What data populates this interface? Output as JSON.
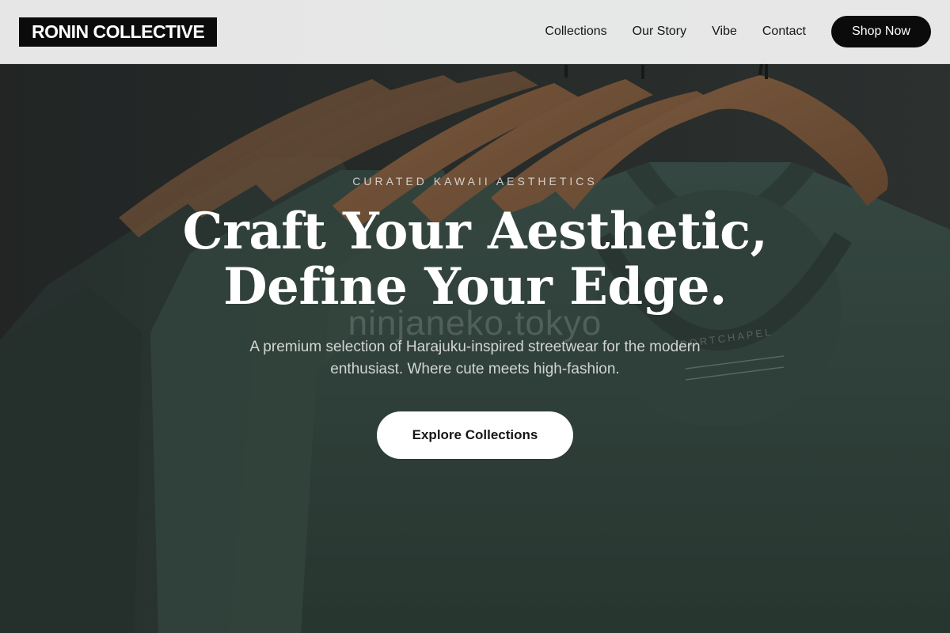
{
  "header": {
    "logo": "RONIN COLLECTIVE",
    "nav": [
      {
        "label": "Collections"
      },
      {
        "label": "Our Story"
      },
      {
        "label": "Vibe"
      },
      {
        "label": "Contact"
      }
    ],
    "shop_button": "Shop Now"
  },
  "hero": {
    "eyebrow": "CURATED KAWAII AESTHETICS",
    "headline_line1": "Craft Your Aesthetic,",
    "headline_line2": "Define Your Edge.",
    "watermark": "ninjaneko.tokyo",
    "subtext_line1": "A premium selection of Harajuku-inspired streetwear for the modern",
    "subtext_line2": "enthusiast. Where cute meets high-fashion.",
    "cta": "Explore Collections",
    "background_photo": {
      "description_icon": "hanging-tshirts-photo",
      "label_text": "PORTCHAPEL"
    }
  },
  "colors": {
    "header_bg": "#f5f5f5",
    "logo_bg": "#0b0b0b",
    "button_dark": "#0b0b0b",
    "cta_bg": "#ffffff",
    "shirt_green": "#3d564e",
    "hanger_wood": "#a9744c",
    "wall_dark": "#2a2d2c"
  }
}
